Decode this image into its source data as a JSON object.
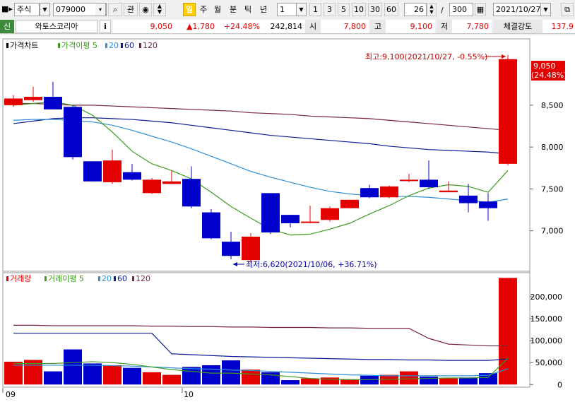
{
  "toolbar": {
    "market": "주식",
    "code": "079000",
    "interest_label": "관",
    "period_hot": "일",
    "period_week": "주",
    "period_month": "월",
    "period_min": "분",
    "period_tick": "틱",
    "period_year": "년",
    "interval_value": "1",
    "interval_presets": [
      "1",
      "3",
      "5",
      "10",
      "30",
      "60"
    ],
    "visible_count": "26",
    "total_count": "300",
    "date": "2021/10/27"
  },
  "info": {
    "badge": "신",
    "name": "와토스코리아",
    "info_button": "i",
    "price": "9,050",
    "change": "▲1,780",
    "change_rate": "+24.48%",
    "volume": "242,814",
    "open_label": "시",
    "open": "7,800",
    "high_label": "고",
    "high": "9,100",
    "low_label": "저",
    "low": "7,780",
    "strength_label": "체결강도",
    "strength": "137.9"
  },
  "colors": {
    "up": "#e50000",
    "down": "#0000cc",
    "ma5": "#3c9a1e",
    "ma20": "#2e8fd8",
    "ma60": "#0a1a96",
    "ma120": "#7a2048"
  },
  "chart_data": [
    {
      "type": "candlestick",
      "legend": [
        "가격차트",
        "가격이평 5",
        "20",
        "60",
        "120"
      ],
      "ylim": [
        6550,
        9250
      ],
      "y_ticks": [
        "8,500",
        "8,000",
        "7,500",
        "7,000"
      ],
      "x_ticks": [
        "09",
        "10"
      ],
      "annotation_high": "최고:9,100(2021/10/27, -0.55%)",
      "annotation_low": "최저:6,620(2021/10/06, +36.71%)",
      "last_label": [
        "9,050",
        "(24.48%)"
      ],
      "candles": [
        {
          "o": 8500,
          "h": 8620,
          "l": 8480,
          "c": 8580
        },
        {
          "o": 8560,
          "h": 8720,
          "l": 8540,
          "c": 8600
        },
        {
          "o": 8600,
          "h": 8780,
          "l": 8450,
          "c": 8450
        },
        {
          "o": 8480,
          "h": 8500,
          "l": 7850,
          "c": 7880
        },
        {
          "o": 7830,
          "h": 7830,
          "l": 7590,
          "c": 7590
        },
        {
          "o": 7580,
          "h": 7970,
          "l": 7560,
          "c": 7840
        },
        {
          "o": 7700,
          "h": 7800,
          "l": 7600,
          "c": 7610
        },
        {
          "o": 7450,
          "h": 7630,
          "l": 7440,
          "c": 7610
        },
        {
          "o": 7560,
          "h": 7720,
          "l": 7560,
          "c": 7590
        },
        {
          "o": 7620,
          "h": 7770,
          "l": 7270,
          "c": 7290
        },
        {
          "o": 7220,
          "h": 7260,
          "l": 6900,
          "c": 6910
        },
        {
          "o": 6870,
          "h": 6990,
          "l": 6660,
          "c": 6700
        },
        {
          "o": 6650,
          "h": 6970,
          "l": 6620,
          "c": 6930
        },
        {
          "o": 7450,
          "h": 7450,
          "l": 6960,
          "c": 6980
        },
        {
          "o": 7190,
          "h": 7190,
          "l": 7040,
          "c": 7090
        },
        {
          "o": 7100,
          "h": 7300,
          "l": 7090,
          "c": 7110
        },
        {
          "o": 7130,
          "h": 7290,
          "l": 7110,
          "c": 7270
        },
        {
          "o": 7270,
          "h": 7370,
          "l": 7270,
          "c": 7370
        },
        {
          "o": 7510,
          "h": 7550,
          "l": 7390,
          "c": 7400
        },
        {
          "o": 7400,
          "h": 7540,
          "l": 7390,
          "c": 7530
        },
        {
          "o": 7600,
          "h": 7680,
          "l": 7580,
          "c": 7610
        },
        {
          "o": 7610,
          "h": 7840,
          "l": 7500,
          "c": 7520
        },
        {
          "o": 7460,
          "h": 7590,
          "l": 7460,
          "c": 7480
        },
        {
          "o": 7420,
          "h": 7560,
          "l": 7220,
          "c": 7330
        },
        {
          "o": 7350,
          "h": 7450,
          "l": 7120,
          "c": 7270
        },
        {
          "o": 7800,
          "h": 9100,
          "l": 7780,
          "c": 9050
        }
      ],
      "ma5": [
        8500,
        8520,
        8540,
        8500,
        8380,
        8180,
        7950,
        7800,
        7720,
        7620,
        7460,
        7290,
        7150,
        7020,
        6950,
        6960,
        7020,
        7090,
        7200,
        7300,
        7420,
        7510,
        7550,
        7530,
        7460,
        7720
      ],
      "ma20": [
        8320,
        8330,
        8330,
        8320,
        8300,
        8260,
        8200,
        8130,
        8060,
        7980,
        7890,
        7800,
        7710,
        7640,
        7580,
        7520,
        7470,
        7440,
        7420,
        7410,
        7410,
        7400,
        7380,
        7360,
        7340,
        7380
      ],
      "ma60": [
        8280,
        8310,
        8340,
        8350,
        8350,
        8340,
        8330,
        8310,
        8290,
        8260,
        8230,
        8200,
        8170,
        8140,
        8120,
        8100,
        8080,
        8060,
        8040,
        8010,
        7990,
        7970,
        7960,
        7950,
        7940,
        7920
      ],
      "ma120": [
        8520,
        8520,
        8510,
        8500,
        8500,
        8490,
        8480,
        8470,
        8460,
        8450,
        8440,
        8430,
        8410,
        8400,
        8390,
        8370,
        8360,
        8350,
        8340,
        8320,
        8300,
        8280,
        8260,
        8240,
        8220,
        8200
      ]
    },
    {
      "type": "bar",
      "legend": [
        "거래량",
        "거래이평 5",
        "20",
        "60",
        "120"
      ],
      "ylim": [
        -6000,
        245000
      ],
      "y_ticks": [
        "200,000",
        "150,000",
        "100,000",
        "50,000",
        "0"
      ],
      "volumes": [
        52000,
        56000,
        30000,
        80000,
        48000,
        44000,
        38000,
        28000,
        22000,
        40000,
        44000,
        55000,
        34000,
        28000,
        10000,
        14000,
        16000,
        12000,
        20000,
        22000,
        30000,
        18000,
        14000,
        16000,
        26000,
        242814
      ],
      "vol_ma5": [
        48000,
        48000,
        48000,
        50000,
        52000,
        50000,
        46000,
        40000,
        34000,
        30000,
        26000,
        26000,
        24000,
        22000,
        18000,
        14000,
        12000,
        11000,
        11000,
        12000,
        13000,
        14000,
        15000,
        15000,
        16000,
        60000
      ],
      "vol_ma20": [
        44000,
        44000,
        44000,
        44000,
        44000,
        43000,
        42000,
        40000,
        38000,
        36000,
        35000,
        33000,
        32000,
        30000,
        28000,
        26000,
        24000,
        22000,
        21000,
        20000,
        20000,
        20000,
        20000,
        20000,
        21000,
        36000
      ],
      "vol_ma60": [
        117000,
        117000,
        117000,
        117000,
        117000,
        117000,
        117000,
        117000,
        70000,
        68000,
        66000,
        64000,
        63000,
        62000,
        61000,
        60000,
        59000,
        58000,
        57000,
        57000,
        56000,
        56000,
        55000,
        55000,
        55000,
        58000
      ],
      "vol_ma120": [
        135000,
        135000,
        134000,
        134000,
        134000,
        134000,
        134000,
        133000,
        133000,
        132000,
        132000,
        131000,
        131000,
        130000,
        130000,
        130000,
        129000,
        129000,
        128000,
        128000,
        128000,
        105000,
        92000,
        90000,
        88000,
        88000
      ]
    }
  ]
}
